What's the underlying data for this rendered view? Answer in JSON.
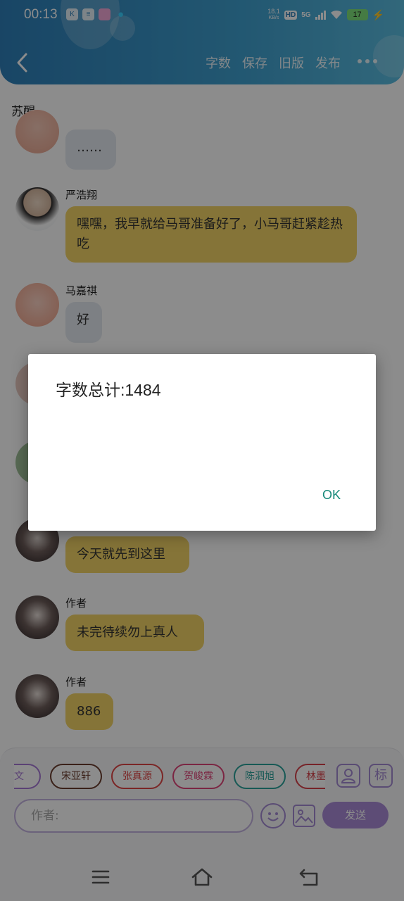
{
  "status_bar": {
    "time": "00:13",
    "net_speed_value": "18.1",
    "net_speed_unit": "KB/s",
    "hd_badge": "HD",
    "network": "5G",
    "battery": "17"
  },
  "nav": {
    "actions": [
      "字数",
      "保存",
      "旧版",
      "发布"
    ]
  },
  "chat_title": "苏醒",
  "messages": [
    {
      "sender": "",
      "text": "……",
      "style": "grey",
      "avatar": "pink"
    },
    {
      "sender": "严浩翔",
      "text": "嘿嘿，我早就给马哥准备好了，小马哥赶紧趁热吃",
      "style": "yellow",
      "avatar": "boy"
    },
    {
      "sender": "马嘉祺",
      "text": "好",
      "style": "grey",
      "avatar": "pink"
    },
    {
      "sender": "",
      "text": "今天就先到这里",
      "style": "yellow",
      "avatar": "anime"
    },
    {
      "sender": "作者",
      "text": "未完待续勿上真人",
      "style": "yellow",
      "avatar": "anime"
    },
    {
      "sender": "作者",
      "text": "886",
      "style": "yellow",
      "avatar": "anime"
    }
  ],
  "composer": {
    "chips": [
      {
        "label": "耀文",
        "color": "#a678d6"
      },
      {
        "label": "宋亚轩",
        "color": "#6b3d2e"
      },
      {
        "label": "张真源",
        "color": "#e04646"
      },
      {
        "label": "贺峻霖",
        "color": "#e0457a"
      },
      {
        "label": "陈泗旭",
        "color": "#2aa39b"
      },
      {
        "label": "林墨",
        "color": "#d8404a"
      }
    ],
    "tag_button": "标",
    "input_placeholder": "作者:",
    "send_label": "发送"
  },
  "dialog": {
    "message": "字数总计:1484",
    "ok_label": "OK"
  },
  "colors": {
    "header_start": "#2e7fb9",
    "header_end": "#5bbde0",
    "bubble_yellow": "#f3d466",
    "bubble_grey": "#e4eaf0",
    "accent_purple": "#a98ad8",
    "dialog_ok": "#17897a"
  }
}
